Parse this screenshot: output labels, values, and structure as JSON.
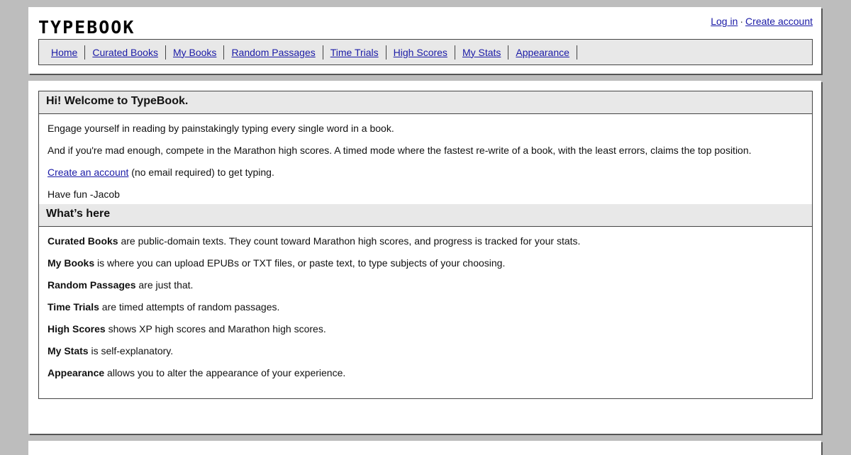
{
  "header": {
    "logo": "TYPEBOOK",
    "login_label": "Log in",
    "separator": "·",
    "create_account_label": "Create account"
  },
  "nav": {
    "items": [
      {
        "label": "Home"
      },
      {
        "label": "Curated Books"
      },
      {
        "label": "My Books"
      },
      {
        "label": "Random Passages"
      },
      {
        "label": "Time Trials"
      },
      {
        "label": "High Scores"
      },
      {
        "label": "My Stats"
      },
      {
        "label": "Appearance"
      }
    ]
  },
  "welcome": {
    "title": "Hi! Welcome to TypeBook.",
    "p1": "Engage yourself in reading by painstakingly typing every single word in a book.",
    "p2": "And if you're mad enough, compete in the Marathon high scores. A timed mode where the fastest re-write of a book, with the least errors, claims the top position.",
    "p3_link": "Create an account",
    "p3_rest": " (no email required) to get typing.",
    "p4": "Have fun -Jacob"
  },
  "whats_here": {
    "title": "What’s here",
    "items": [
      {
        "term": "Curated Books",
        "desc": " are public-domain texts. They count toward Marathon high scores, and progress is tracked for your stats."
      },
      {
        "term": "My Books",
        "desc": " is where you can upload EPUBs or TXT files, or paste text, to type subjects of your choosing."
      },
      {
        "term": "Random Passages",
        "desc": " are just that."
      },
      {
        "term": "Time Trials",
        "desc": " are timed attempts of random passages."
      },
      {
        "term": "High Scores",
        "desc": " shows XP high scores and Marathon high scores."
      },
      {
        "term": "My Stats",
        "desc": " is self-explanatory."
      },
      {
        "term": "Appearance",
        "desc": " allows you to alter the appearance of your experience."
      }
    ]
  }
}
